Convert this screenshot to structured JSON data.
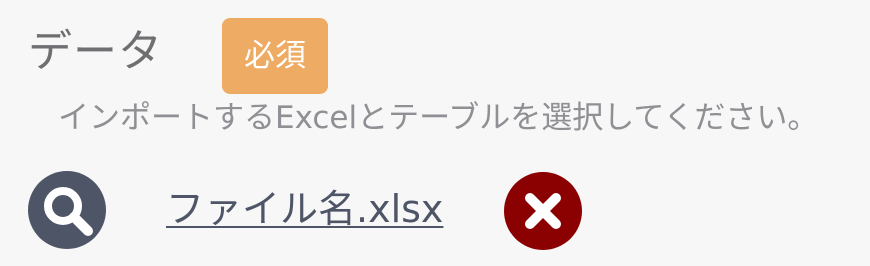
{
  "section": {
    "title": "データ",
    "required_badge": "必須",
    "instruction": "インポートするExcelとテーブルを選択してください。"
  },
  "file": {
    "name": "ファイル名.xlsx"
  },
  "icons": {
    "search": "search-icon",
    "remove": "close-icon"
  },
  "colors": {
    "badge": "#eeab64",
    "search_button": "#4e5566",
    "file_link": "#4e5566",
    "remove_button": "#8b0000"
  }
}
